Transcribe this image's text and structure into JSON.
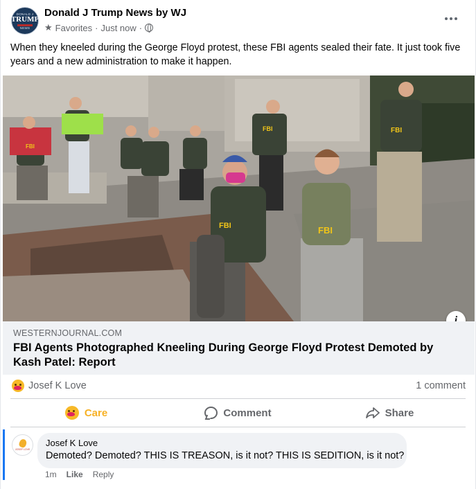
{
  "post": {
    "page_name": "Donald J Trump News by WJ",
    "avatar_text_small": "DONALD J",
    "avatar_text_big": "TRUMP",
    "avatar_text_footer": "NEWS",
    "audience": "Favorites",
    "time": "Just now",
    "text": "When they kneeled during the George Floyd protest, these FBI agents sealed their fate. It just took five years and a new administration to make it happen."
  },
  "photo": {
    "vest_label": "FBI"
  },
  "link": {
    "domain": "WESTERNJOURNAL.COM",
    "title": "FBI Agents Photographed Kneeling During George Floyd Protest Demoted by Kash Patel: Report"
  },
  "reactions": {
    "reactor": "Josef K Love",
    "comment_count": "1 comment"
  },
  "actions": {
    "care": "Care",
    "comment": "Comment",
    "share": "Share"
  },
  "comment": {
    "author": "Josef K Love",
    "text": "Demoted? Demoted? THIS IS TREASON, is it not? THIS IS SEDITION, is it not?",
    "time": "1m",
    "like": "Like",
    "reply": "Reply",
    "avatar_caption": "JOSEF LOVE"
  },
  "colors": {
    "care": "#f7b125",
    "link_bg": "#f0f2f5",
    "accent": "#1877f2",
    "secondary_text": "#65676b"
  }
}
